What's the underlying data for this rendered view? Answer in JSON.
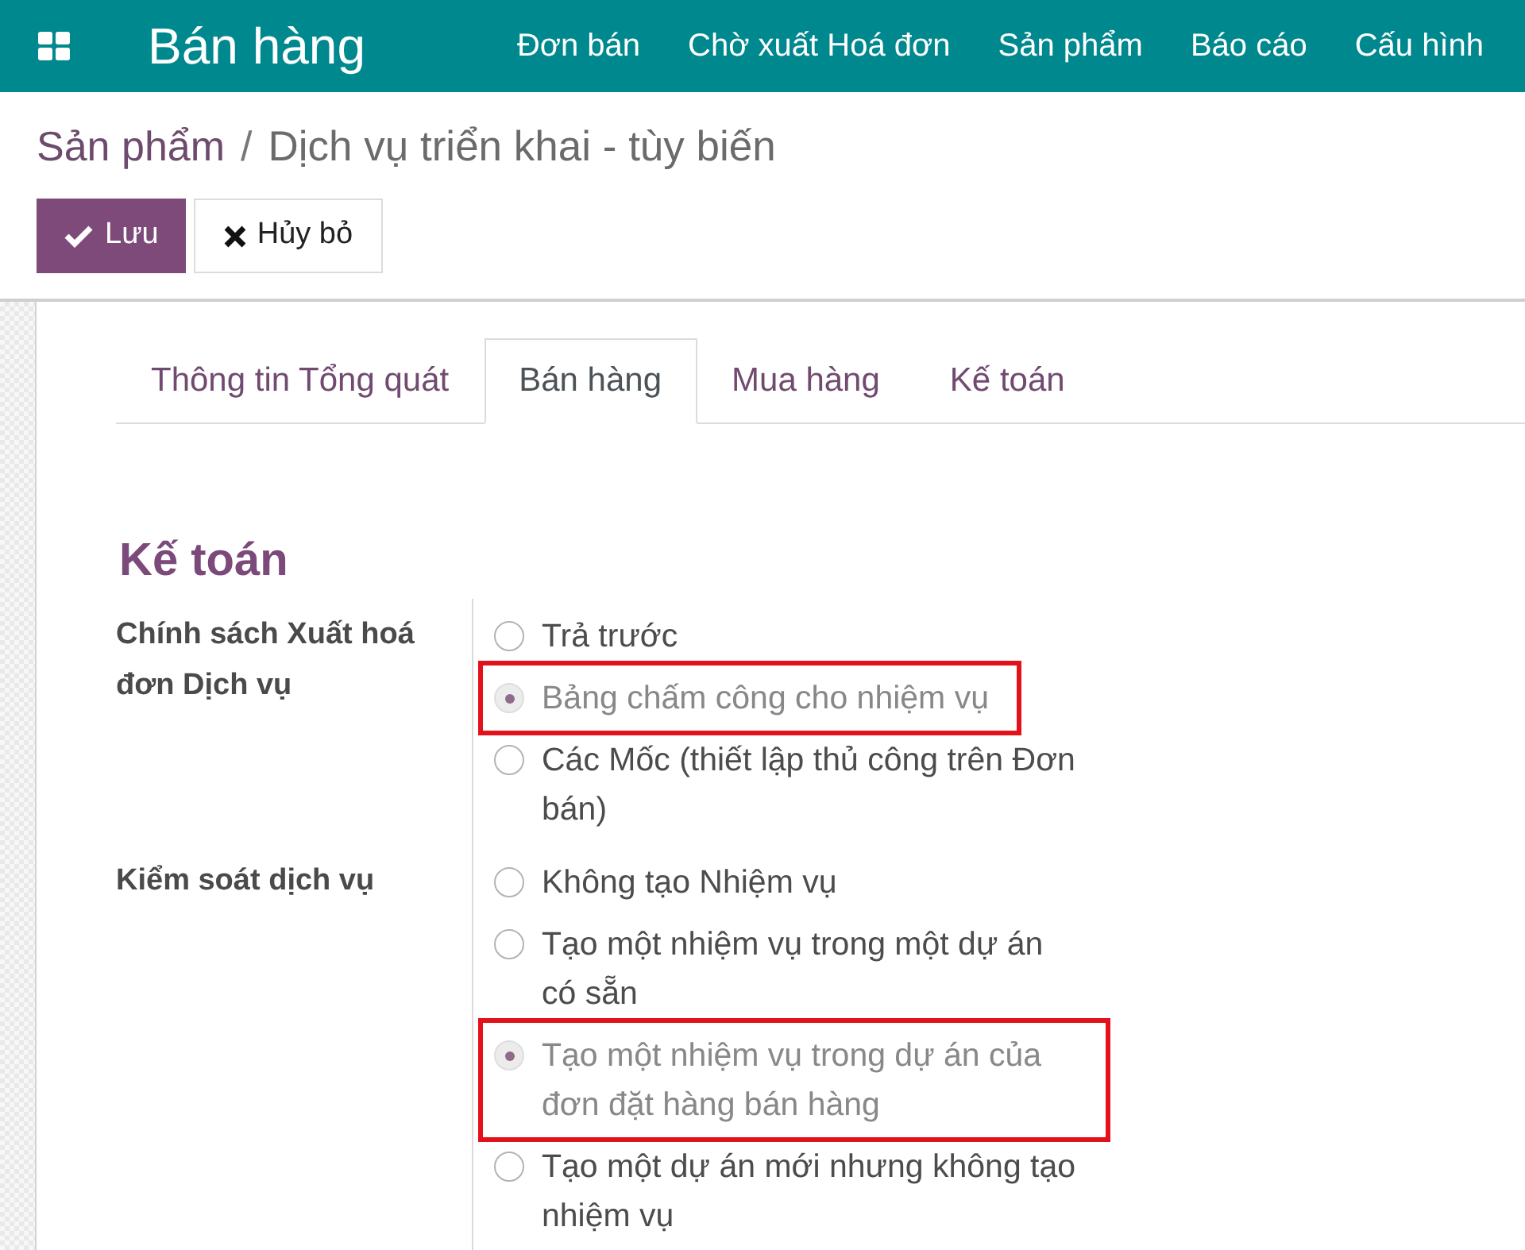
{
  "navbar": {
    "app_title": "Bán hàng",
    "menu": [
      "Đơn bán",
      "Chờ xuất Hoá đơn",
      "Sản phẩm",
      "Báo cáo",
      "Cấu hình"
    ]
  },
  "breadcrumb": {
    "parent": "Sản phẩm",
    "separator": "/",
    "current": "Dịch vụ triển khai - tùy biến"
  },
  "buttons": [
    {
      "label": "Lưu",
      "kind": "save"
    },
    {
      "label": "Hủy bỏ",
      "kind": "discard"
    }
  ],
  "tabs": [
    {
      "label": "Thông tin Tổng quát",
      "selected": false
    },
    {
      "label": "Bán hàng",
      "selected": true
    },
    {
      "label": "Mua hàng",
      "selected": false
    },
    {
      "label": "Kế toán",
      "selected": false
    }
  ],
  "section": {
    "title": "Kế toán",
    "fields": [
      {
        "label": "Chính sách Xuất hoá đơn Dịch vụ",
        "options": [
          {
            "label": "Trả trước",
            "selected": false,
            "highlighted": false
          },
          {
            "label": "Bảng chấm công cho nhiệm vụ",
            "selected": true,
            "highlighted": true
          },
          {
            "label": "Các Mốc (thiết lập thủ công trên Đơn bán)",
            "selected": false,
            "highlighted": false
          }
        ]
      },
      {
        "label": "Kiểm soát dịch vụ",
        "options": [
          {
            "label": "Không tạo Nhiệm vụ",
            "selected": false,
            "highlighted": false
          },
          {
            "label": "Tạo một nhiệm vụ trong một dự án có sẵn",
            "selected": false,
            "highlighted": false
          },
          {
            "label": "Tạo một nhiệm vụ trong dự án của đơn đặt hàng bán hàng",
            "selected": true,
            "highlighted": true
          },
          {
            "label": "Tạo một dự án mới nhưng không tạo nhiệm vụ",
            "selected": false,
            "highlighted": false
          }
        ]
      }
    ]
  }
}
